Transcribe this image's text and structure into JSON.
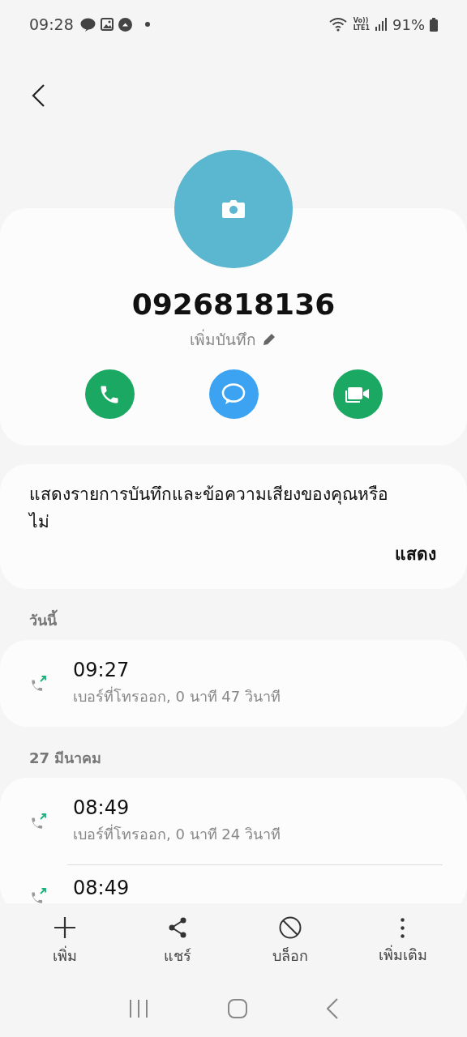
{
  "status_bar": {
    "time": "09:28",
    "battery": "91%",
    "volte": "Vo))",
    "lte": "LTE1"
  },
  "contact": {
    "number": "0926818136",
    "note_prompt": "เพิ่มบันทึก"
  },
  "actions": [
    {
      "kind": "call"
    },
    {
      "kind": "message"
    },
    {
      "kind": "video"
    }
  ],
  "prompt": {
    "text": "แสดงรายการบันทึกและข้อความเสียงของคุณหรือไม่",
    "button": "แสดง"
  },
  "log_groups": [
    {
      "heading": "วันนี้",
      "entries": [
        {
          "kind": "outgoing",
          "time": "09:27",
          "detail": "เบอร์ที่โทรออก, 0 นาที 47 วินาที"
        }
      ]
    },
    {
      "heading": "27 มีนาคม",
      "entries": [
        {
          "kind": "outgoing",
          "time": "08:49",
          "detail": "เบอร์ที่โทรออก, 0 นาที 24 วินาที"
        },
        {
          "kind": "outgoing",
          "time": "08:49"
        }
      ]
    }
  ],
  "toolbar": [
    {
      "kind": "add",
      "label": "เพิ่ม"
    },
    {
      "kind": "share",
      "label": "แชร์"
    },
    {
      "kind": "block",
      "label": "บล็อก"
    },
    {
      "kind": "more",
      "label": "เพิ่มเติม"
    }
  ]
}
